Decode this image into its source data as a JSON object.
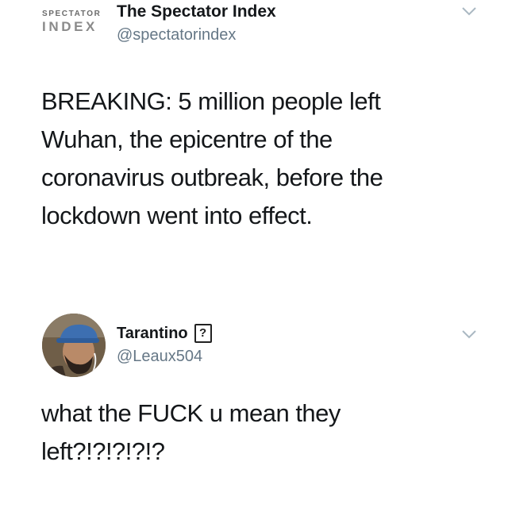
{
  "tweet1": {
    "logo_top": "SPECTATOR",
    "logo_bottom": "INDEX",
    "display_name": "The Spectator Index",
    "handle": "@spectatorindex",
    "text": "BREAKING: 5 million people left\nWuhan, the epicentre of the\ncoronavirus outbreak, before the\nlockdown went into effect.",
    "menu_icon": "chevron-down-icon"
  },
  "tweet2": {
    "display_name": "Tarantino",
    "name_emoji": "?",
    "handle": "@Leaux504",
    "text": "what the FUCK u mean they\nleft?!?!?!?!?",
    "menu_icon": "chevron-down-icon"
  },
  "colors": {
    "text_primary": "#14171a",
    "text_secondary": "#657786",
    "chevron": "#aab8c2",
    "background": "#ffffff"
  }
}
